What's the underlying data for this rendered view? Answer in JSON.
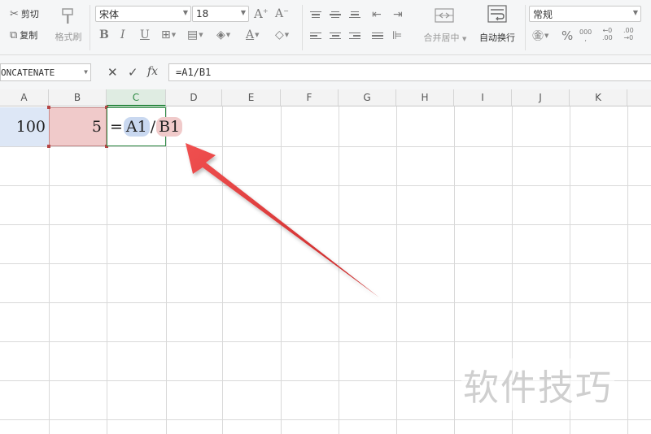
{
  "ribbon": {
    "clipboard": {
      "cut_label": "剪切",
      "copy_label": "复制",
      "format_painter_label": "格式刷"
    },
    "font": {
      "name": "宋体",
      "size": "18",
      "increase_glyph": "A⁺",
      "decrease_glyph": "A⁻"
    },
    "alignment": {
      "merge_center_label": "合并居中",
      "wrap_text_label": "自动换行"
    },
    "number": {
      "format": "常规",
      "thousands_glyph": "000",
      "percent_glyph": "%",
      "inc_decimal_glyph": "+0\n.00",
      "dec_decimal_glyph": ".00\n→.0"
    }
  },
  "formula_bar": {
    "name_box": "ONCATENATE",
    "cancel_glyph": "✕",
    "confirm_glyph": "✓",
    "fx_glyph": "fx",
    "formula": "=A1/B1"
  },
  "sheet": {
    "columns": [
      "A",
      "B",
      "C",
      "D",
      "E",
      "F",
      "G",
      "H",
      "I",
      "J",
      "K"
    ],
    "active_column": "C",
    "cells": {
      "A1": "100",
      "B1": "5"
    },
    "editing": {
      "eq": "=",
      "ref1": "A1",
      "op": "/",
      "ref2": "B1"
    }
  },
  "watermark": "软件技巧",
  "colors": {
    "ref_a": "#c9d8f0",
    "ref_b": "#f0caca",
    "active_green": "#2f8a45",
    "arrow_red": "#e03c3c"
  }
}
